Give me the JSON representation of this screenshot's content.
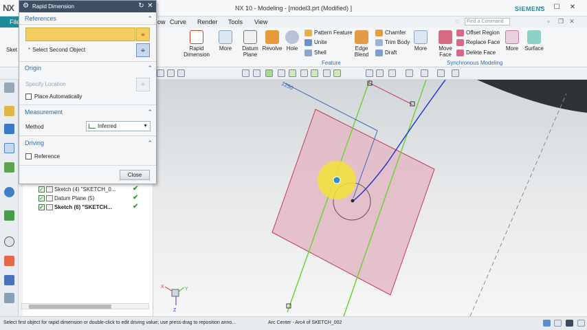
{
  "app": {
    "logo": "NX",
    "title": "NX 10 - Modeling - [model3.prt (Modified) ]",
    "brand": "SIEMENS",
    "brand_color": "#1a8c9a"
  },
  "menu": {
    "file": "File",
    "partial_view": "ow",
    "curve": "Curve",
    "render": "Render",
    "tools": "Tools",
    "view": "View",
    "search_placeholder": "Find a Command"
  },
  "ribbon": {
    "rapid_dimension": [
      "Rapid",
      "Dimension"
    ],
    "more1": "More",
    "datum_plane": [
      "Datum",
      "Plane"
    ],
    "revolve": "Revolve",
    "hole": "Hole",
    "pattern_feature": "Pattern Feature",
    "unite": "Unite",
    "shell": "Shell",
    "edge_blend": [
      "Edge",
      "Blend"
    ],
    "chamfer": "Chamfer",
    "trim_body": "Trim Body",
    "draft": "Draft",
    "more2": "More",
    "move_face": [
      "Move",
      "Face"
    ],
    "offset_region": "Offset Region",
    "replace_face": "Replace Face",
    "delete_face": "Delete Face",
    "more3": "More",
    "surface": "Surface",
    "group_feature": "Feature",
    "group_sync": "Synchronous Modeling",
    "sketch_partial": "Sket",
    "feature_caret": "▾"
  },
  "dialog": {
    "title": "Rapid Dimension",
    "references": {
      "header": "References",
      "select_second": "Select Second Object"
    },
    "origin": {
      "header": "Origin",
      "specify_location": "Specify Location",
      "place_automatically": "Place Automatically"
    },
    "measurement": {
      "header": "Measurement",
      "method_label": "Method",
      "method_value": "Inferred"
    },
    "driving": {
      "header": "Driving",
      "reference": "Reference"
    },
    "close": "Close"
  },
  "navigator": {
    "rows": [
      {
        "label": "Sketch (4) \"SKETCH_0...",
        "bold": false
      },
      {
        "label": "Datum Plane (5)",
        "bold": false
      },
      {
        "label": "Sketch (6) \"SKETCH...",
        "bold": true
      }
    ]
  },
  "graphics": {
    "dim_label": "1250",
    "axis_labels": {
      "x": "X",
      "y": "Y",
      "z": "Z"
    }
  },
  "status": {
    "prompt": "Select first object for rapid dimension or double-click to edit driving value; use press-drag to reposition anno...",
    "message": "Arc Center - Arc4 of SKETCH_002"
  },
  "colors": {
    "accent": "#2d6fb1",
    "selection_yellow": "#f3cd5f",
    "sketch_plane_fill": "#e3b9c6",
    "sketch_plane_edge": "#c23a5a",
    "datum_line": "#6fd13a",
    "curve_blue": "#2636c9",
    "highlight": "#f5e23a"
  }
}
